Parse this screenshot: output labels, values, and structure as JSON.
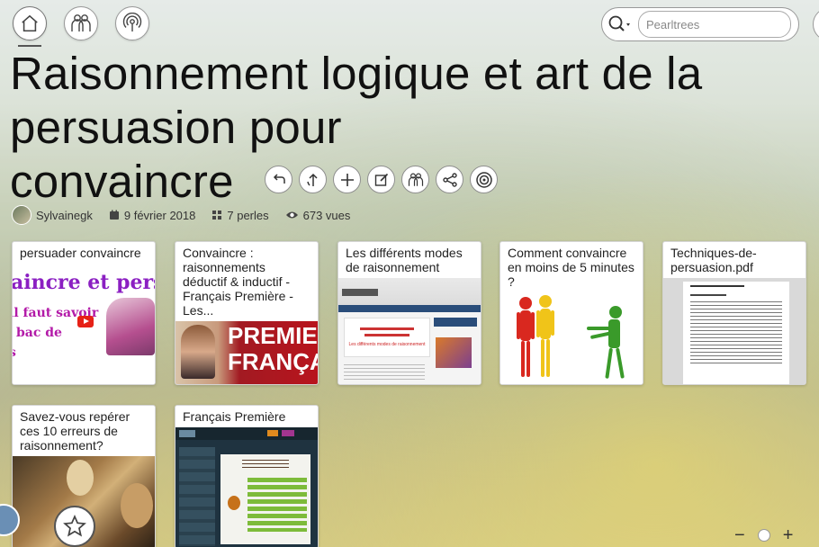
{
  "nav": {
    "home": "home-icon",
    "team": "team-icon",
    "broadcast": "broadcast-icon"
  },
  "search": {
    "placeholder": "Pearltrees"
  },
  "title": {
    "line1": "Raisonnement logique et art de la",
    "line2": "persuasion pour",
    "line3": "convaincre"
  },
  "title_actions": [
    "back-icon",
    "up-icon",
    "add-icon",
    "edit-icon",
    "team-icon",
    "share-icon",
    "target-icon"
  ],
  "meta": {
    "author": "Sylvainegk",
    "date": "9 février 2018",
    "pearls": "7 perles",
    "views": "673 vues"
  },
  "cards": [
    {
      "title": "persuader convaincre",
      "thumb_text": "aincre et persu",
      "thumb_lines": [
        "il faut savoir",
        "bac de",
        "s"
      ]
    },
    {
      "title": "Convaincre : raisonnements déductif & inductif - Français Première - Les...",
      "thumb_text": "PREMIE FRANÇA"
    },
    {
      "title": "Les différents modes de raisonnement",
      "thumb_caption": "Les différents modes de raisonnement"
    },
    {
      "title": "Comment convaincre en moins de 5 minutes ?"
    },
    {
      "title": "Techniques-de-persuasion.pdf"
    },
    {
      "title": "Savez-vous repérer ces 10 erreurs de raisonnement?"
    },
    {
      "title": "Français Première"
    }
  ],
  "colors": {
    "title": "#111111",
    "card_border": "#d5d5d5",
    "youtube": "#e62117",
    "purple_text": "#8b1fc2"
  }
}
